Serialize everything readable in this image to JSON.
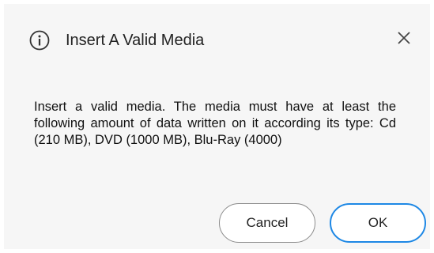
{
  "dialog": {
    "title": "Insert A Valid Media",
    "title_icon": "info-icon",
    "close_icon": "close-icon",
    "message": "Insert a valid media. The media must have at least the following amount of data written on it according its type: Cd (210 MB), DVD (1000 MB), Blu-Ray (4000)",
    "buttons": {
      "cancel_label": "Cancel",
      "ok_label": "OK"
    }
  },
  "colors": {
    "dialog_background": "#f6f6f6",
    "primary_button_border": "#1e88e5",
    "secondary_button_border": "#8c8c8c"
  }
}
